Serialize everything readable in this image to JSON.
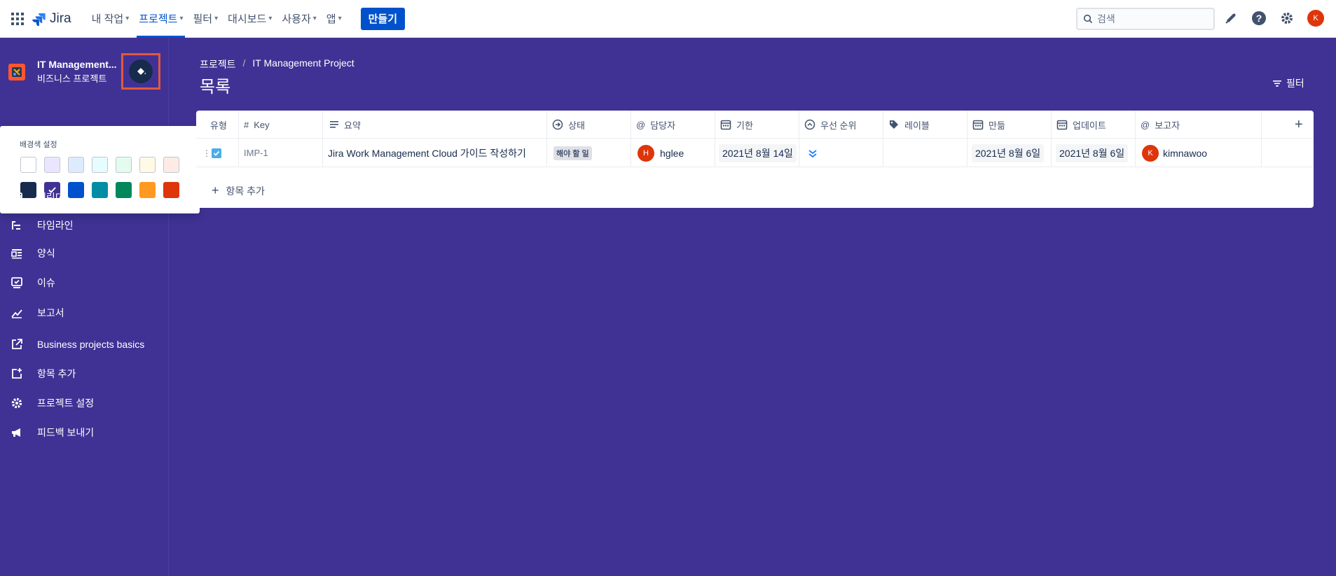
{
  "topbar": {
    "app_name": "Jira",
    "nav": [
      {
        "label": "내 작업"
      },
      {
        "label": "프로젝트"
      },
      {
        "label": "필터"
      },
      {
        "label": "대시보드"
      },
      {
        "label": "사용자"
      },
      {
        "label": "앱"
      }
    ],
    "create_label": "만들기",
    "search_placeholder": "검색",
    "user_initial": "K"
  },
  "sidebar": {
    "project_name": "IT Management...",
    "project_type": "비즈니스 프로젝트",
    "popup": {
      "label": "배경색 설정",
      "colors_top": [
        "#ffffff",
        "#eae6ff",
        "#deebff",
        "#e6fcff",
        "#e3fcef",
        "#fffae6",
        "#ffebe6"
      ],
      "colors_bottom": [
        "#172b4d",
        "#403294",
        "#0052cc",
        "#008da6",
        "#00875a",
        "#ff991f",
        "#de350b"
      ],
      "selected": "#403294"
    },
    "items": [
      {
        "label": "캘린더",
        "icon": "calendar-icon"
      },
      {
        "label": "타임라인",
        "icon": "timeline-icon"
      },
      {
        "label": "양식",
        "icon": "form-icon"
      },
      {
        "label": "이슈",
        "icon": "issues-icon"
      },
      {
        "label": "보고서",
        "icon": "reports-icon"
      },
      {
        "label": "Business projects basics",
        "icon": "external-link-icon"
      },
      {
        "label": "항목 추가",
        "icon": "add-item-icon"
      },
      {
        "label": "프로젝트 설정",
        "icon": "gear-icon"
      },
      {
        "label": "피드백 보내기",
        "icon": "megaphone-icon"
      }
    ]
  },
  "main": {
    "breadcrumb": [
      "프로젝트",
      "IT Management Project"
    ],
    "title": "목록",
    "filter_label": "필터",
    "columns": [
      "유형",
      "Key",
      "요약",
      "상태",
      "담당자",
      "기한",
      "우선 순위",
      "레이블",
      "만듦",
      "업데이트",
      "보고자"
    ],
    "rows": [
      {
        "key": "IMP-1",
        "summary": "Jira Work Management Cloud 가이드 작성하기",
        "status": "해야 할 일",
        "assignee": "hglee",
        "assignee_initial": "H",
        "due": "2021년 8월 14일",
        "priority": "lowest",
        "label": "",
        "created": "2021년 8월 6일",
        "updated": "2021년 8월 6일",
        "reporter": "kimnawoo",
        "reporter_initial": "K"
      }
    ],
    "add_item_label": "항목 추가"
  },
  "colors": {
    "background": "#403294",
    "brand": "#0052cc",
    "avatar": "#de350b",
    "highlight": "#e2583e"
  }
}
